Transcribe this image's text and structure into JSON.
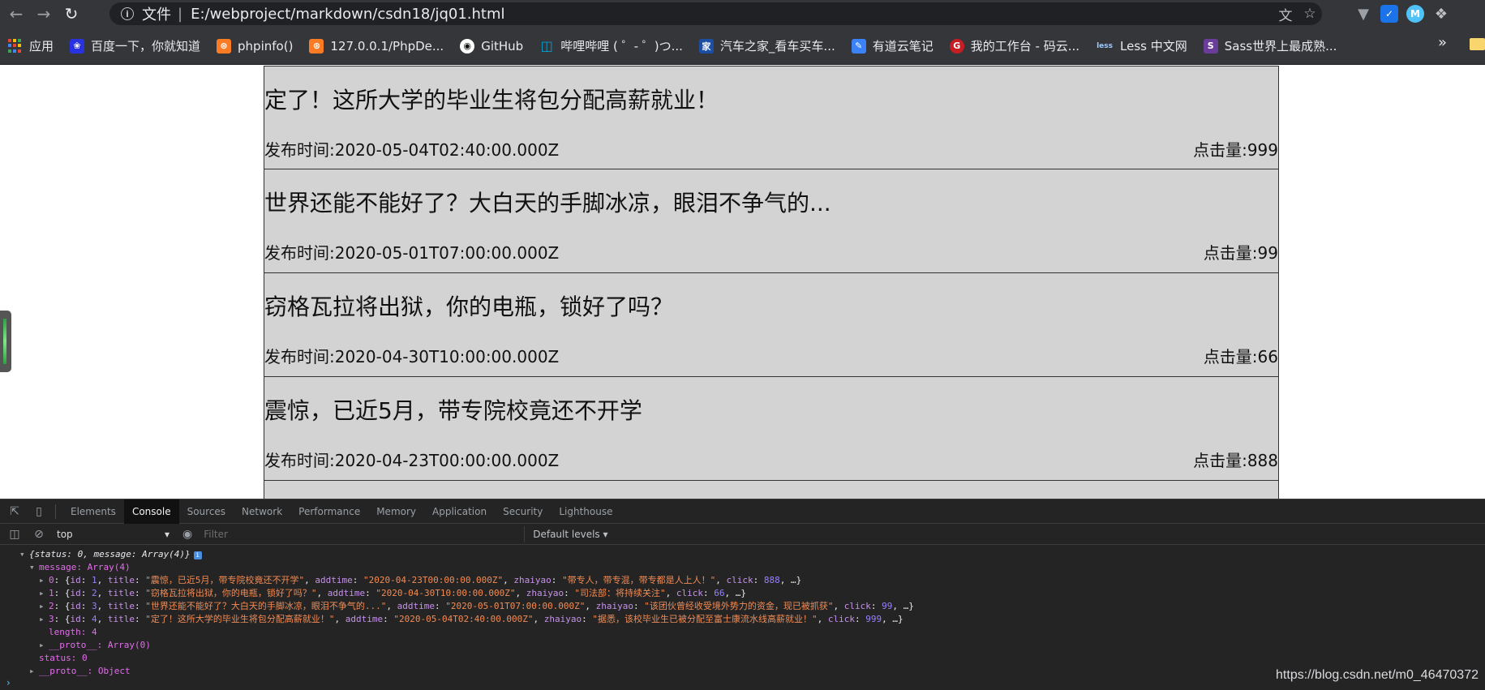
{
  "browser": {
    "scheme_label": "文件",
    "url": "E:/webproject/markdown/csdn18/jq01.html"
  },
  "bookmarks": [
    {
      "label": "应用",
      "icon": "apps-grid-icon",
      "color": "#ea4335"
    },
    {
      "label": "百度一下，你就知道",
      "icon": "baidu-icon",
      "color": "#2932e1"
    },
    {
      "label": "phpinfo()",
      "icon": "xampp-icon",
      "color": "#fb7a24"
    },
    {
      "label": "127.0.0.1/PhpDe...",
      "icon": "xampp-icon",
      "color": "#fb7a24"
    },
    {
      "label": "GitHub",
      "icon": "github-icon",
      "color": "#ffffff"
    },
    {
      "label": "哔哩哔哩 ( ゜- ゜)つ...",
      "icon": "bilibili-icon",
      "color": "#00a1d6"
    },
    {
      "label": "汽车之家_看车买车...",
      "icon": "autohome-icon",
      "color": "#1c4fa3"
    },
    {
      "label": "有道云笔记",
      "icon": "youdao-note-icon",
      "color": "#3b82f6"
    },
    {
      "label": "我的工作台 - 码云...",
      "icon": "gitee-icon",
      "color": "#c71d23"
    },
    {
      "label": "Less 中文网",
      "icon": "less-icon",
      "color": "#1d365d"
    },
    {
      "label": "Sass世界上最成熟...",
      "icon": "sass-icon",
      "color": "#6a3d9a"
    }
  ],
  "news": [
    {
      "title": "定了！这所大学的毕业生将包分配高薪就业！",
      "time": "发布时间:2020-05-04T02:40:00.000Z",
      "click": "点击量:999"
    },
    {
      "title": "世界还能不能好了？大白天的手脚冰凉，眼泪不争气的...",
      "time": "发布时间:2020-05-01T07:00:00.000Z",
      "click": "点击量:99"
    },
    {
      "title": "窃格瓦拉将出狱，你的电瓶，锁好了吗？",
      "time": "发布时间:2020-04-30T10:00:00.000Z",
      "click": "点击量:66"
    },
    {
      "title": "震惊，已近5月，带专院校竟还不开学",
      "time": "发布时间:2020-04-23T00:00:00.000Z",
      "click": "点击量:888"
    }
  ],
  "devtools": {
    "tabs": [
      "Elements",
      "Console",
      "Sources",
      "Network",
      "Performance",
      "Memory",
      "Application",
      "Security",
      "Lighthouse"
    ],
    "active_tab": "Console",
    "context": "top",
    "filter_placeholder": "Filter",
    "levels": "Default levels"
  },
  "console": {
    "summary": "{status: 0, message: Array(4)}",
    "message_label": "message: Array(4)",
    "rows": [
      {
        "idx": "0",
        "id": "1",
        "title": "\"震惊，已近5月，带专院校竟还不开学\"",
        "addtime": "\"2020-04-23T00:00:00.000Z\"",
        "zhaiyao": "\"带专人，带专混，带专都是人上人！\"",
        "click": "888"
      },
      {
        "idx": "1",
        "id": "2",
        "title": "\"窃格瓦拉将出狱，你的电瓶，锁好了吗？\"",
        "addtime": "\"2020-04-30T10:00:00.000Z\"",
        "zhaiyao": "\"司法部：将持续关注\"",
        "click": "66"
      },
      {
        "idx": "2",
        "id": "3",
        "title": "\"世界还能不能好了？大白天的手脚冰凉，眼泪不争气的...\"",
        "addtime": "\"2020-05-01T07:00:00.000Z\"",
        "zhaiyao": "\"该团伙曾经收受境外势力的资金，现已被抓获\"",
        "click": "99"
      },
      {
        "idx": "3",
        "id": "4",
        "title": "\"定了！这所大学的毕业生将包分配高薪就业！\"",
        "addtime": "\"2020-05-04T02:40:00.000Z\"",
        "zhaiyao": "\"据悉，该校毕业生已被分配至富士康流水线高薪就业！\"",
        "click": "999"
      }
    ],
    "length_label": "length: 4",
    "proto_array": "__proto__: Array(0)",
    "status_label": "status: 0",
    "proto_object": "__proto__: Object"
  },
  "watermark": "https://blog.csdn.net/m0_46470372"
}
